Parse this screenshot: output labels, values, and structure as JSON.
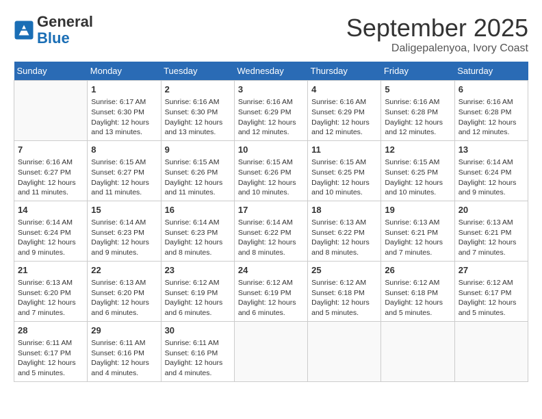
{
  "logo": {
    "line1": "General",
    "line2": "Blue"
  },
  "title": "September 2025",
  "subtitle": "Daligepalenyoa, Ivory Coast",
  "days_of_week": [
    "Sunday",
    "Monday",
    "Tuesday",
    "Wednesday",
    "Thursday",
    "Friday",
    "Saturday"
  ],
  "weeks": [
    [
      {
        "day": "",
        "info": ""
      },
      {
        "day": "1",
        "info": "Sunrise: 6:17 AM\nSunset: 6:30 PM\nDaylight: 12 hours\nand 13 minutes."
      },
      {
        "day": "2",
        "info": "Sunrise: 6:16 AM\nSunset: 6:30 PM\nDaylight: 12 hours\nand 13 minutes."
      },
      {
        "day": "3",
        "info": "Sunrise: 6:16 AM\nSunset: 6:29 PM\nDaylight: 12 hours\nand 12 minutes."
      },
      {
        "day": "4",
        "info": "Sunrise: 6:16 AM\nSunset: 6:29 PM\nDaylight: 12 hours\nand 12 minutes."
      },
      {
        "day": "5",
        "info": "Sunrise: 6:16 AM\nSunset: 6:28 PM\nDaylight: 12 hours\nand 12 minutes."
      },
      {
        "day": "6",
        "info": "Sunrise: 6:16 AM\nSunset: 6:28 PM\nDaylight: 12 hours\nand 12 minutes."
      }
    ],
    [
      {
        "day": "7",
        "info": "Sunrise: 6:16 AM\nSunset: 6:27 PM\nDaylight: 12 hours\nand 11 minutes."
      },
      {
        "day": "8",
        "info": "Sunrise: 6:15 AM\nSunset: 6:27 PM\nDaylight: 12 hours\nand 11 minutes."
      },
      {
        "day": "9",
        "info": "Sunrise: 6:15 AM\nSunset: 6:26 PM\nDaylight: 12 hours\nand 11 minutes."
      },
      {
        "day": "10",
        "info": "Sunrise: 6:15 AM\nSunset: 6:26 PM\nDaylight: 12 hours\nand 10 minutes."
      },
      {
        "day": "11",
        "info": "Sunrise: 6:15 AM\nSunset: 6:25 PM\nDaylight: 12 hours\nand 10 minutes."
      },
      {
        "day": "12",
        "info": "Sunrise: 6:15 AM\nSunset: 6:25 PM\nDaylight: 12 hours\nand 10 minutes."
      },
      {
        "day": "13",
        "info": "Sunrise: 6:14 AM\nSunset: 6:24 PM\nDaylight: 12 hours\nand 9 minutes."
      }
    ],
    [
      {
        "day": "14",
        "info": "Sunrise: 6:14 AM\nSunset: 6:24 PM\nDaylight: 12 hours\nand 9 minutes."
      },
      {
        "day": "15",
        "info": "Sunrise: 6:14 AM\nSunset: 6:23 PM\nDaylight: 12 hours\nand 9 minutes."
      },
      {
        "day": "16",
        "info": "Sunrise: 6:14 AM\nSunset: 6:23 PM\nDaylight: 12 hours\nand 8 minutes."
      },
      {
        "day": "17",
        "info": "Sunrise: 6:14 AM\nSunset: 6:22 PM\nDaylight: 12 hours\nand 8 minutes."
      },
      {
        "day": "18",
        "info": "Sunrise: 6:13 AM\nSunset: 6:22 PM\nDaylight: 12 hours\nand 8 minutes."
      },
      {
        "day": "19",
        "info": "Sunrise: 6:13 AM\nSunset: 6:21 PM\nDaylight: 12 hours\nand 7 minutes."
      },
      {
        "day": "20",
        "info": "Sunrise: 6:13 AM\nSunset: 6:21 PM\nDaylight: 12 hours\nand 7 minutes."
      }
    ],
    [
      {
        "day": "21",
        "info": "Sunrise: 6:13 AM\nSunset: 6:20 PM\nDaylight: 12 hours\nand 7 minutes."
      },
      {
        "day": "22",
        "info": "Sunrise: 6:13 AM\nSunset: 6:20 PM\nDaylight: 12 hours\nand 6 minutes."
      },
      {
        "day": "23",
        "info": "Sunrise: 6:12 AM\nSunset: 6:19 PM\nDaylight: 12 hours\nand 6 minutes."
      },
      {
        "day": "24",
        "info": "Sunrise: 6:12 AM\nSunset: 6:19 PM\nDaylight: 12 hours\nand 6 minutes."
      },
      {
        "day": "25",
        "info": "Sunrise: 6:12 AM\nSunset: 6:18 PM\nDaylight: 12 hours\nand 5 minutes."
      },
      {
        "day": "26",
        "info": "Sunrise: 6:12 AM\nSunset: 6:18 PM\nDaylight: 12 hours\nand 5 minutes."
      },
      {
        "day": "27",
        "info": "Sunrise: 6:12 AM\nSunset: 6:17 PM\nDaylight: 12 hours\nand 5 minutes."
      }
    ],
    [
      {
        "day": "28",
        "info": "Sunrise: 6:11 AM\nSunset: 6:17 PM\nDaylight: 12 hours\nand 5 minutes."
      },
      {
        "day": "29",
        "info": "Sunrise: 6:11 AM\nSunset: 6:16 PM\nDaylight: 12 hours\nand 4 minutes."
      },
      {
        "day": "30",
        "info": "Sunrise: 6:11 AM\nSunset: 6:16 PM\nDaylight: 12 hours\nand 4 minutes."
      },
      {
        "day": "",
        "info": ""
      },
      {
        "day": "",
        "info": ""
      },
      {
        "day": "",
        "info": ""
      },
      {
        "day": "",
        "info": ""
      }
    ]
  ]
}
